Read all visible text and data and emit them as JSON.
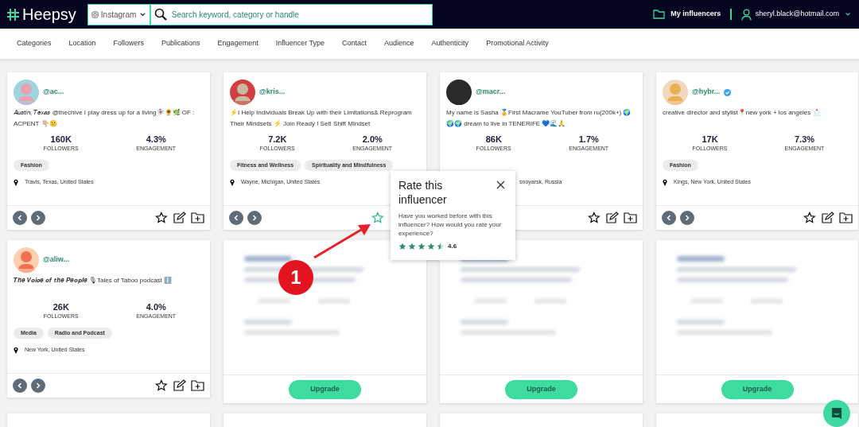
{
  "header": {
    "logo": "Heepsy",
    "platform": "Instagram",
    "search": {
      "placeholder": "Search keyword, category or handle"
    },
    "my_influencers": "My influencers",
    "account": "sheryl.black@hotmail.com"
  },
  "filters": [
    "Categories",
    "Location",
    "Followers",
    "Publications",
    "Engagement",
    "Influencer Type",
    "Contact",
    "Audience",
    "Authenticity",
    "Promotional Activity"
  ],
  "cards": [
    {
      "kind": "profile",
      "handle": "@ac...",
      "verified": false,
      "bio": "𝐴𝑢𝑠𝑡𝑖𝑛, 𝑇𝑒𝑥𝑎𝑠 @thechive I play dress up for a living🧚🏼‍♀️🌻🌿 OF : ACPENT 👇🏼🙂",
      "followers": "160K",
      "followers_label": "FOLLOWERS",
      "engagement": "4.3%",
      "engagement_label": "ENGAGEMENT",
      "tags": [
        "Fashion"
      ],
      "location": "Travis, Texas, United States",
      "covered": false,
      "star_active": false
    },
    {
      "kind": "profile",
      "handle": "@kris...",
      "verified": false,
      "bio": "⚡I Help Individuals Break Up with their Limitations& Reprogram Their Mindsets ⚡ Join Ready ! Set! Shift Mindset",
      "followers": "7.2K",
      "followers_label": "FOLLOWERS",
      "engagement": "2.0%",
      "engagement_label": "ENGAGEMENT",
      "tags": [
        "Fitness and Wellness",
        "Spirituality and Mindfulness"
      ],
      "location": "Wayne, Michigan, United States",
      "covered": false,
      "star_active": true,
      "edit_tools_hidden": true
    },
    {
      "kind": "profile",
      "handle": "@macr...",
      "verified": false,
      "bio": "My name is Sasha 🏅First Macrame YouTuber from ru(200k+) 🌍🌍🌍 dream to live in TENERIFE 💙🌊🙏",
      "followers": "86K",
      "followers_label": "FOLLOWERS",
      "engagement": "1.7%",
      "engagement_label": "ENGAGEMENT",
      "location": "snoyarsk, Russia",
      "covered": true,
      "star_active": false
    },
    {
      "kind": "profile",
      "handle": "@hybr...",
      "verified": true,
      "bio": "creative director and stylist📍new york + los angeles 📩",
      "followers": "17K",
      "followers_label": "FOLLOWERS",
      "engagement": "7.3%",
      "engagement_label": "ENGAGEMENT",
      "tags": [
        "Fashion"
      ],
      "location": "Kings, New York, United States",
      "covered": false,
      "star_active": false
    },
    {
      "kind": "profile",
      "handle": "@aliw...",
      "verified": false,
      "bio": "𝑻𝒉𝒆 𝑽𝒐𝒊𝒄𝒆 𝒐𝒇 𝒕𝒉𝒆 𝑷𝒆𝒐𝒑𝒍𝒆 🎙Tales of Taboo podcast ℹ️",
      "followers": "26K",
      "followers_label": "FOLLOWERS",
      "engagement": "4.0%",
      "engagement_label": "ENGAGEMENT",
      "tags": [
        "Media",
        "Radio and Podcast"
      ],
      "location": "New York, United States",
      "covered": false,
      "star_active": false
    },
    {
      "kind": "locked",
      "button": "Upgrade"
    },
    {
      "kind": "locked",
      "button": "Upgrade"
    },
    {
      "kind": "locked",
      "button": "Upgrade"
    },
    {
      "kind": "stub"
    },
    {
      "kind": "stub"
    },
    {
      "kind": "stub"
    },
    {
      "kind": "stub"
    }
  ],
  "rating_popup": {
    "title": "Rate this influencer",
    "text": "Have you worked before with this influencer? How would you rate your experience?",
    "stars": 4.5,
    "rating": "4.6"
  },
  "annotation": {
    "number": "1"
  }
}
